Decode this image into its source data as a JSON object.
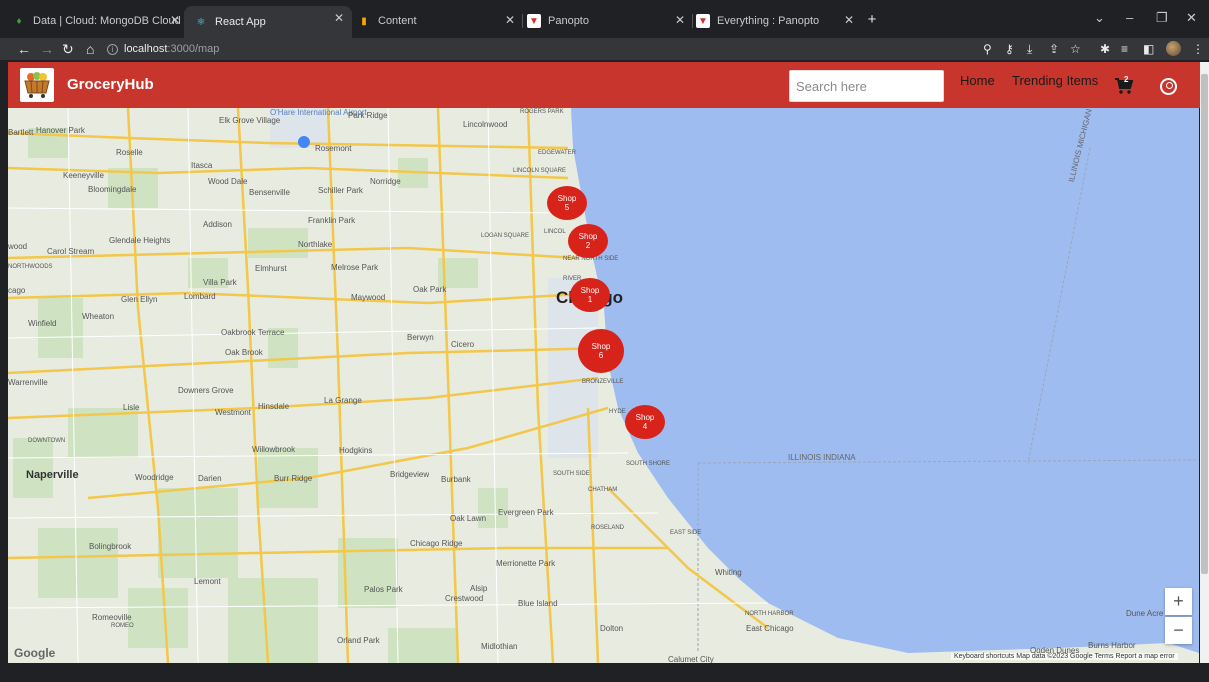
{
  "browser": {
    "tabs": [
      {
        "title": "Data | Cloud: MongoDB Cloud",
        "icon": "mongodb-leaf-icon"
      },
      {
        "title": "React App",
        "icon": "react-icon",
        "active": true
      },
      {
        "title": "Content",
        "icon": "bar-chart-icon"
      },
      {
        "title": "Panopto",
        "icon": "panopto-icon"
      },
      {
        "title": "Everything : Panopto",
        "icon": "panopto-icon"
      }
    ],
    "url_host": "localhost",
    "url_path": ":3000/map"
  },
  "app": {
    "brand": "GroceryHub",
    "search_placeholder": "Search here",
    "nav": {
      "home": "Home",
      "trending": "Trending Items"
    },
    "cart_count": "2",
    "colors": {
      "header": "#c8352c",
      "marker": "#d8231b",
      "water": "#9ebcf0"
    }
  },
  "map": {
    "shops": [
      {
        "label": "Shop",
        "number": "5"
      },
      {
        "label": "Shop",
        "number": "2"
      },
      {
        "label": "Shop",
        "number": "1"
      },
      {
        "label": "Shop",
        "number": "6"
      },
      {
        "label": "Shop",
        "number": "4"
      }
    ],
    "places": {
      "elk_grove": "Elk Grove Village",
      "ohare": "O'Hare International Airport",
      "park_ridge": "Park Ridge",
      "lincolnwood": "Lincolnwood",
      "rogers_park": "ROGERS PARK",
      "hanover_park": "Hanover Park",
      "roselle": "Roselle",
      "rosemont": "Rosemont",
      "edgewater": "EDGEWATER",
      "itasca": "Itasca",
      "keeneyville": "Keeneyville",
      "wood_dale": "Wood Dale",
      "norridge": "Norridge",
      "lincoln_square": "LINCOLN SQUARE",
      "bloomingdale": "Bloomingdale",
      "bensenville": "Bensenville",
      "schiller_park": "Schiller Park",
      "franklin_park": "Franklin Park",
      "addison": "Addison",
      "logan_square": "LOGAN SQUARE",
      "lincoln": "LINCOL",
      "glendale_heights": "Glendale Heights",
      "northlake": "Northlake",
      "near_north_side": "NEAR NORTH SIDE",
      "carol_stream": "Carol Stream",
      "northwoods": "NORTHWOODS",
      "elmhurst": "Elmhurst",
      "melrose_park": "Melrose Park",
      "river": "RIVER",
      "villa_park": "Villa Park",
      "lombard": "Lombard",
      "glen_ellyn": "Glen Ellyn",
      "maywood": "Maywood",
      "oak_park": "Oak Park",
      "chicago": "Chicago",
      "wheaton": "Wheaton",
      "winfield": "Winfield",
      "oakbrook_terrace": "Oakbrook Terrace",
      "oak_brook": "Oak Brook",
      "berwyn": "Berwyn",
      "cicero": "Cicero",
      "warrenville": "Warrenville",
      "downers_grove": "Downers Grove",
      "la_grange": "La Grange",
      "bronzeville": "BRONZEVILLE",
      "lisle": "Lisle",
      "westmont": "Westmont",
      "hinsdale": "Hinsdale",
      "hyde_park": "HYDE",
      "downtown": "DOWNTOWN",
      "willowbrook": "Willowbrook",
      "hodgkins": "Hodgkins",
      "naperville": "Naperville",
      "woodridge": "Woodridge",
      "darien": "Darien",
      "burr_ridge": "Burr Ridge",
      "bridgeview": "Bridgeview",
      "burbank": "Burbank",
      "south_side": "SOUTH SIDE",
      "south_shore": "SOUTH SHORE",
      "chatham": "CHATHAM",
      "oak_lawn": "Oak Lawn",
      "evergreen_park": "Evergreen Park",
      "roseland": "ROSELAND",
      "east_side": "EAST SIDE",
      "bolingbrook": "Bolingbrook",
      "chicago_ridge": "Chicago Ridge",
      "merrionette_park": "Merrionette Park",
      "whiting": "Whiting",
      "lemont": "Lemont",
      "palos_park": "Palos Park",
      "alsip": "Alsip",
      "crestwood": "Crestwood",
      "blue_island": "Blue Island",
      "north_harbor": "NORTH HARBOR",
      "romeoville": "Romeoville",
      "romeo": "ROMEO",
      "dolton": "Dolton",
      "east_chicago": "East Chicago",
      "orland_park": "Orland Park",
      "midlothian": "Midlothian",
      "calumet_city": "Calumet City",
      "burns_harbor": "Burns Harbor",
      "ogden_dunes": "Ogden Dunes",
      "dune_acres": "Dune Acre",
      "illinois_michigan": "ILLINOIS MICHIGAN",
      "illinois_indiana": "ILLINOIS INDIANA",
      "bartlett": "Bartlett",
      "wood": "wood",
      "cago": "cago"
    },
    "footer": "Keyboard shortcuts   Map data ©2023 Google   Terms   Report a map error",
    "google_logo": "Google",
    "zoom_in": "+",
    "zoom_out": "−"
  }
}
